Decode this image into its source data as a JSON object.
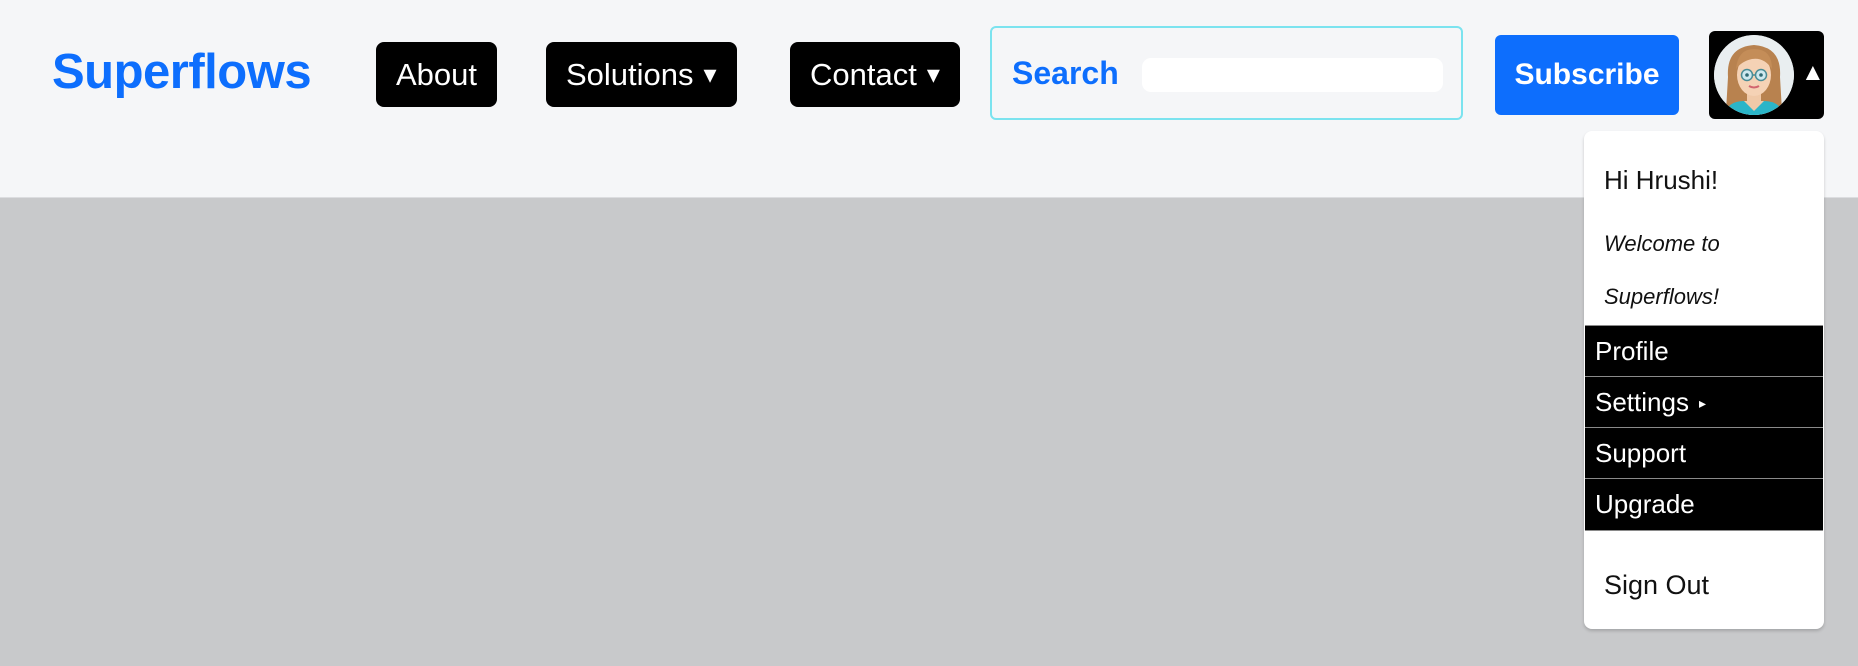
{
  "brand": {
    "name": "Superflows",
    "color": "#0d6efd"
  },
  "nav": {
    "about": "About",
    "solutions": "Solutions",
    "contact": "Contact",
    "dropdown_caret": "▾"
  },
  "search": {
    "label": "Search",
    "value": "",
    "placeholder": ""
  },
  "subscribe": {
    "label": "Subscribe"
  },
  "account": {
    "avatar_icon": "avatar-woman-glasses",
    "caret": "▲"
  },
  "user_menu": {
    "greeting": "Hi Hrushi!",
    "welcome": "Welcome to Superflows!",
    "items": [
      {
        "label": "Profile",
        "caret": ""
      },
      {
        "label": "Settings",
        "caret": "▸"
      },
      {
        "label": "Support",
        "caret": ""
      },
      {
        "label": "Upgrade",
        "caret": ""
      }
    ],
    "signout": "Sign Out"
  }
}
